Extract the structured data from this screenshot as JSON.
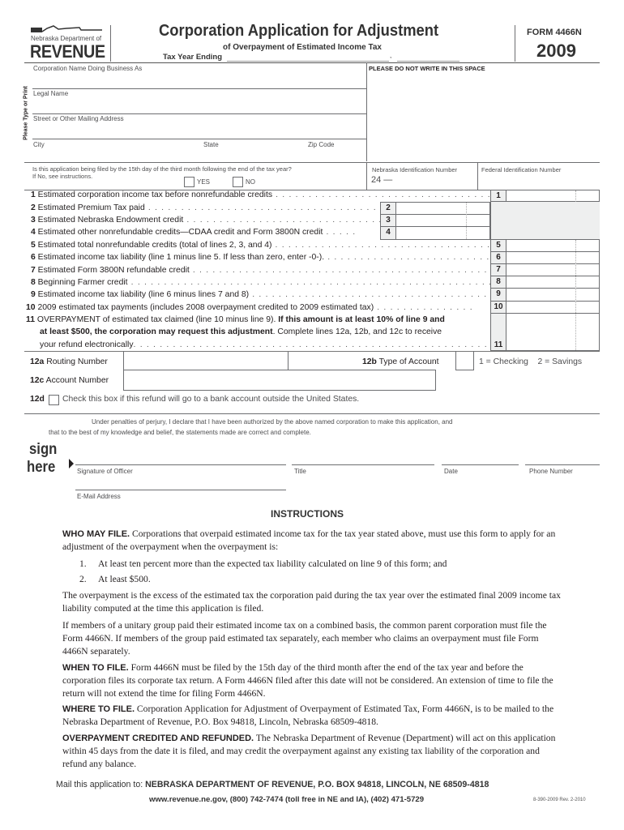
{
  "header": {
    "agency_line": "Nebraska Department of",
    "agency_big": "REVENUE",
    "title": "Corporation Application for Adjustment",
    "subtitle": "of Overpayment of Estimated Income Tax",
    "tax_year_label": "Tax Year Ending",
    "tax_year_comma": ",",
    "form_number": "FORM 4466N",
    "year": "2009"
  },
  "id_block": {
    "side_label": "Please Type or Print",
    "corp_dba_label": "Corporation Name Doing Business As",
    "do_not_write": "PLEASE DO NOT WRITE IN THIS SPACE",
    "legal_name_label": "Legal Name",
    "street_label": "Street or Other Mailing Address",
    "city_label": "City",
    "state_label": "State",
    "zip_label": "Zip Code",
    "filing_question": "Is this application being filed by the 15th day of the third month following the end of the tax year?",
    "filing_note": "If No, see instructions.",
    "yes_label": "YES",
    "no_label": "NO",
    "ne_id_label": "Nebraska Identification Number",
    "ne_id_prefix": "24 —",
    "fed_id_label": "Federal Identification Number"
  },
  "lines": [
    {
      "num": "1",
      "text": "Estimated corporation income tax before nonrefundable credits",
      "box": "1"
    },
    {
      "num": "2",
      "text": "Estimated Premium Tax paid",
      "box": "2"
    },
    {
      "num": "3",
      "text": "Estimated Nebraska Endowment credit",
      "box": "3"
    },
    {
      "num": "4",
      "text": "Estimated other nonrefundable credits—CDAA credit and Form 3800N credit",
      "box": "4"
    },
    {
      "num": "5",
      "text": "Estimated total nonrefundable credits (total of lines 2, 3, and 4)",
      "box": "5"
    },
    {
      "num": "6",
      "text": "Estimated income tax liability (line 1 minus line 5. If less than zero, enter -0-).",
      "box": "6"
    },
    {
      "num": "7",
      "text": "Estimated Form 3800N refundable credit",
      "box": "7"
    },
    {
      "num": "8",
      "text": "Beginning Farmer credit",
      "box": "8"
    },
    {
      "num": "9",
      "text": "Estimated income tax liability (line 6 minus lines 7 and 8)",
      "box": "9"
    },
    {
      "num": "10",
      "text": "2009 estimated tax payments (includes 2008 overpayment credited to 2009 estimated tax)",
      "box": "10"
    },
    {
      "num": "11",
      "text_a": "OVERPAYMENT of estimated tax claimed (line 10 minus line 9). ",
      "text_a_bold": "If this amount is at least 10% of line 9 and",
      "text_b_bold": "at least $500, the corporation may request this adjustment",
      "text_b": ". Complete lines 12a, 12b, and 12c to receive",
      "text_c": "your refund electronically",
      "box": "11"
    }
  ],
  "bank": {
    "routing_num": "12a",
    "routing_label": "Routing Number",
    "type_num": "12b",
    "type_label": "Type of Account",
    "type_options": "1 = Checking    2 = Savings",
    "account_num": "12c",
    "account_label": "Account Number",
    "foreign_num": "12d",
    "foreign_label": "Check this box if this refund will go to a bank account outside the United States."
  },
  "signature": {
    "perjury_1": "Under penalties of perjury, I declare that I have been authorized by the above named corporation to make this application, and",
    "perjury_2": "that to the best of my knowledge and belief, the statements made are correct and complete.",
    "sign": "sign",
    "here": "here",
    "signature_label": "Signature of Officer",
    "title_label": "Title",
    "date_label": "Date",
    "phone_label": "Phone Number",
    "email_label": "E-Mail Address"
  },
  "instructions": {
    "heading": "INSTRUCTIONS",
    "who_head": "WHO MAY FILE.",
    "who_text": " Corporations  that overpaid estimated income tax for the tax year stated above, must use this form to apply for an adjustment of the overpayment when the overpayment is:",
    "list": [
      {
        "n": "1.",
        "text": "At least ten percent more than the expected tax liability calculated on line 9 of this form; and"
      },
      {
        "n": "2.",
        "text": "At least $500."
      }
    ],
    "para_overpayment": "The overpayment is the excess of the estimated tax the corporation paid during the tax year over the estimated final 2009 income tax liability computed at the time this application is filed.",
    "para_unitary": "If members of a unitary group paid their estimated income tax on a combined basis, the common parent corporation must file the Form 4466N. If members of the group paid estimated tax separately, each member who claims an overpayment must file Form 4466N separately.",
    "when_head": "WHEN TO FILE.",
    "when_text": " Form 4466N must be filed by the 15th day of the third month after the end of the tax year and before the corporation files its corporate tax return. A Form 4466N filed after this date will not be considered. An extension of time to file the return will not extend the time for filing Form 4466N.",
    "where_head": "WHERE TO FILE.",
    "where_text": " Corporation Application for Adjustment of Overpayment of Estimated Tax, Form 4466N, is to be mailed to the Nebraska Department of Revenue, P.O. Box 94818, Lincoln, Nebraska 68509-4818.",
    "credited_head": "OVERPAYMENT CREDITED AND REFUNDED.",
    "credited_text": " The Nebraska Department of Revenue (Department) will act on this application within 45 days from the date it is filed, and may credit the overpayment against any existing tax liability of the corporation and refund any balance."
  },
  "footer": {
    "mail_prefix": "Mail this application to: ",
    "mail_address": "NEBRASKA DEPARTMENT OF REVENUE, P.O. BOX 94818, LINCOLN, NE 68509-4818",
    "contact": "www.revenue.ne.gov, (800) 742-7474 (toll free in NE and IA), (402) 471-5729",
    "revision": "8-390-2009 Rev. 2-2010"
  }
}
